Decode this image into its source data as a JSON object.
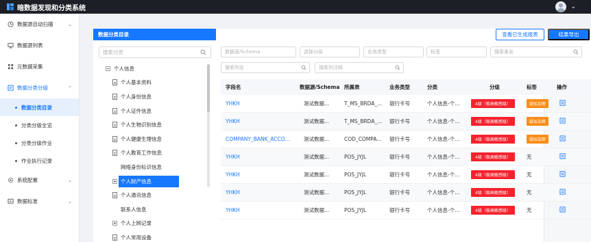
{
  "app": {
    "title": "暗数据发现和分类系统"
  },
  "colors": {
    "accent": "#1677ff",
    "topbar": "#1c1f26",
    "level_badge": "#f5222d",
    "tag_badge": "#fa8c16"
  },
  "sidebar": {
    "items": [
      {
        "label": "数据源自动扫描",
        "icon": "clock-icon",
        "caret": "⌄"
      },
      {
        "label": "数据源列表",
        "icon": "monitor-icon"
      },
      {
        "label": "元数据采集",
        "icon": "grid-icon"
      },
      {
        "label": "数据分类分级",
        "icon": "tag-icon",
        "caret": "⌃"
      },
      {
        "label": "系统配置",
        "icon": "gear-icon",
        "caret": "⌄"
      },
      {
        "label": "数据标准",
        "icon": "chart-icon",
        "caret": "⌄"
      }
    ],
    "sub_items": [
      {
        "label": "数据分类目录",
        "active": true
      },
      {
        "label": "分类分级全览"
      },
      {
        "label": "分类分级作业"
      },
      {
        "label": "作业执行记录"
      }
    ]
  },
  "tree": {
    "header": "数据分类目录",
    "search_placeholder": "搜索分类",
    "root": "个人信息",
    "children": [
      "个人基本资料",
      "个人身份信息",
      "个人证件信息",
      "个人生物识别信息",
      "个人健康生理信息",
      "个人教育工作信息",
      "网络身份标识信息",
      "个人财产信息",
      "个人通讯信息",
      "联系人信息",
      "个人上网记录",
      "个人常用设备"
    ],
    "selected": "个人财产信息"
  },
  "toolbar": {
    "view_report_label": "查看已生成报表",
    "export_label": "结果导出"
  },
  "filters": {
    "datasource_placeholder": "数据源/Schema",
    "level_placeholder": "选择分级",
    "biz_type_placeholder": "业务类型",
    "tag_placeholder": "标签",
    "table_name_placeholder": "搜索表名",
    "column_name_placeholder": "搜索列名",
    "column_comment_placeholder": "搜索列注释"
  },
  "table": {
    "columns": [
      "字段名",
      "数据源/Schema",
      "所属表",
      "业务类型",
      "分类",
      "分级",
      "标签",
      "操作"
    ],
    "rows": [
      {
        "field": "YHKH",
        "source": "测试数据...",
        "table": "T_MS_BRDA_...",
        "biz": "银行卡号",
        "class": "个人信息-个...",
        "level": "4级（极高敏感级）",
        "tag": "疑似加密"
      },
      {
        "field": "YHKH",
        "source": "测试数据...",
        "table": "T_MS_BRDA_...",
        "biz": "银行卡号",
        "class": "个人信息-个...",
        "level": "4级（极高敏感级）",
        "tag": "疑似加密"
      },
      {
        "field": "COMPANY_BANK_ACCO...",
        "source": "测试数据...",
        "table": "COD_COMPA...",
        "biz": "银行卡号",
        "class": "个人信息-个...",
        "level": "4级（极高敏感级）",
        "tag": "疑似加密"
      },
      {
        "field": "YHKH",
        "source": "测试数据...",
        "table": "POS_JYJL",
        "biz": "银行卡号",
        "class": "个人信息-个...",
        "level": "4级（极高敏感级）",
        "tag": "无"
      },
      {
        "field": "YHKH",
        "source": "测试数据...",
        "table": "POS_JYJL",
        "biz": "银行卡号",
        "class": "个人信息-个...",
        "level": "4级（极高敏感级）",
        "tag": "无"
      },
      {
        "field": "YHKH",
        "source": "测试数据...",
        "table": "POS_JYJL",
        "biz": "银行卡号",
        "class": "个人信息-个...",
        "level": "4级（极高敏感级）",
        "tag": "无"
      },
      {
        "field": "YHKH",
        "source": "测试数据...",
        "table": "POS_JYJL",
        "biz": "银行卡号",
        "class": "个人信息-个...",
        "level": "4级（极高敏感级）",
        "tag": "无"
      }
    ]
  }
}
